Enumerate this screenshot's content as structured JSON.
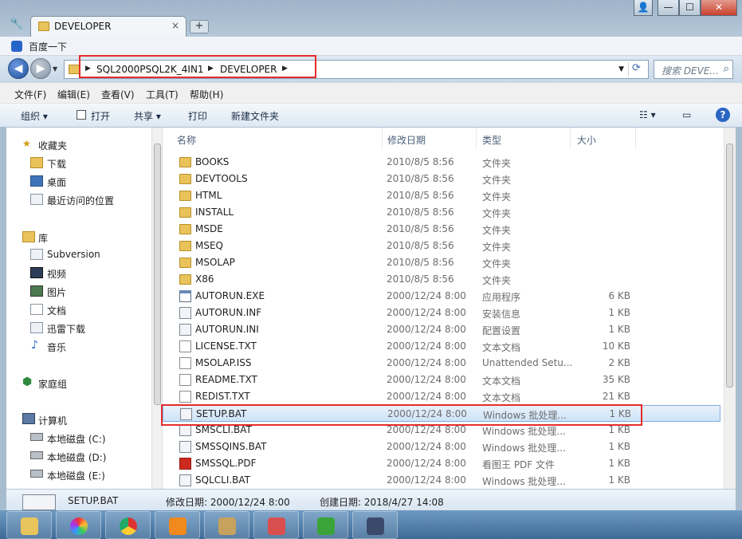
{
  "tab": {
    "title": "DEVELOPER",
    "close": "×",
    "new": "+"
  },
  "window_controls": {
    "user": "👤",
    "minimize": "—",
    "maximize": "☐",
    "close": "✕"
  },
  "bookmarks": {
    "baidu_label": "百度一下",
    "baidu_icon": "🐾"
  },
  "address": {
    "crumbs": [
      "SQL2000PSQL2K_4IN1",
      "DEVELOPER"
    ],
    "search_placeholder": "搜索 DEVE..."
  },
  "menu": [
    "文件(F)",
    "编辑(E)",
    "查看(V)",
    "工具(T)",
    "帮助(H)"
  ],
  "toolbar": {
    "organize": "组织 ▾",
    "open": "打开",
    "share": "共享 ▾",
    "print": "打印",
    "new_folder": "新建文件夹",
    "help": "?"
  },
  "nav": {
    "favorites": "收藏夹",
    "downloads": "下载",
    "desktop": "桌面",
    "recent": "最近访问的位置",
    "libraries": "库",
    "subversion": "Subversion",
    "videos": "视频",
    "pictures": "图片",
    "documents": "文档",
    "thunder": "迅雷下载",
    "music": "音乐",
    "homegroup": "家庭组",
    "computer": "计算机",
    "drive_c": "本地磁盘 (C:)",
    "drive_d": "本地磁盘 (D:)",
    "drive_e": "本地磁盘 (E:)"
  },
  "columns": {
    "name": "名称",
    "modified": "修改日期",
    "type": "类型",
    "size": "大小"
  },
  "files": [
    {
      "name": "BOOKS",
      "date": "2010/8/5 8:56",
      "type": "文件夹",
      "size": "",
      "icon": "folder"
    },
    {
      "name": "DEVTOOLS",
      "date": "2010/8/5 8:56",
      "type": "文件夹",
      "size": "",
      "icon": "folder"
    },
    {
      "name": "HTML",
      "date": "2010/8/5 8:56",
      "type": "文件夹",
      "size": "",
      "icon": "folder"
    },
    {
      "name": "INSTALL",
      "date": "2010/8/5 8:56",
      "type": "文件夹",
      "size": "",
      "icon": "folder"
    },
    {
      "name": "MSDE",
      "date": "2010/8/5 8:56",
      "type": "文件夹",
      "size": "",
      "icon": "folder"
    },
    {
      "name": "MSEQ",
      "date": "2010/8/5 8:56",
      "type": "文件夹",
      "size": "",
      "icon": "folder"
    },
    {
      "name": "MSOLAP",
      "date": "2010/8/5 8:56",
      "type": "文件夹",
      "size": "",
      "icon": "folder"
    },
    {
      "name": "X86",
      "date": "2010/8/5 8:56",
      "type": "文件夹",
      "size": "",
      "icon": "folder"
    },
    {
      "name": "AUTORUN.EXE",
      "date": "2000/12/24 8:00",
      "type": "应用程序",
      "size": "6 KB",
      "icon": "exe"
    },
    {
      "name": "AUTORUN.INF",
      "date": "2000/12/24 8:00",
      "type": "安装信息",
      "size": "1 KB",
      "icon": "bat"
    },
    {
      "name": "AUTORUN.INI",
      "date": "2000/12/24 8:00",
      "type": "配置设置",
      "size": "1 KB",
      "icon": "bat"
    },
    {
      "name": "LICENSE.TXT",
      "date": "2000/12/24 8:00",
      "type": "文本文档",
      "size": "10 KB",
      "icon": "doc"
    },
    {
      "name": "MSOLAP.ISS",
      "date": "2000/12/24 8:00",
      "type": "Unattended Setu...",
      "size": "2 KB",
      "icon": "doc"
    },
    {
      "name": "README.TXT",
      "date": "2000/12/24 8:00",
      "type": "文本文档",
      "size": "35 KB",
      "icon": "doc"
    },
    {
      "name": "REDIST.TXT",
      "date": "2000/12/24 8:00",
      "type": "文本文档",
      "size": "21 KB",
      "icon": "doc"
    },
    {
      "name": "SETUP.BAT",
      "date": "2000/12/24 8:00",
      "type": "Windows 批处理...",
      "size": "1 KB",
      "icon": "bat",
      "selected": true
    },
    {
      "name": "SMSCLI.BAT",
      "date": "2000/12/24 8:00",
      "type": "Windows 批处理...",
      "size": "1 KB",
      "icon": "bat"
    },
    {
      "name": "SMSSQINS.BAT",
      "date": "2000/12/24 8:00",
      "type": "Windows 批处理...",
      "size": "1 KB",
      "icon": "bat"
    },
    {
      "name": "SMSSQL.PDF",
      "date": "2000/12/24 8:00",
      "type": "看图王 PDF 文件",
      "size": "1 KB",
      "icon": "pdf"
    },
    {
      "name": "SQLCLI.BAT",
      "date": "2000/12/24 8:00",
      "type": "Windows 批处理...",
      "size": "1 KB",
      "icon": "bat"
    }
  ],
  "details": {
    "filename": "SETUP.BAT",
    "modified": "修改日期: 2000/12/24 8:00",
    "created": "创建日期: 2018/4/27 14:08"
  },
  "taskbar_apps": [
    "file-explorer",
    "color-wheel",
    "chrome",
    "media-player",
    "paint",
    "snipping-tool",
    "clover",
    "network-setup"
  ],
  "colors": {
    "highlight": "#e32d2d",
    "selection": "#cde3f7",
    "taskbar": "#3d6a97"
  }
}
